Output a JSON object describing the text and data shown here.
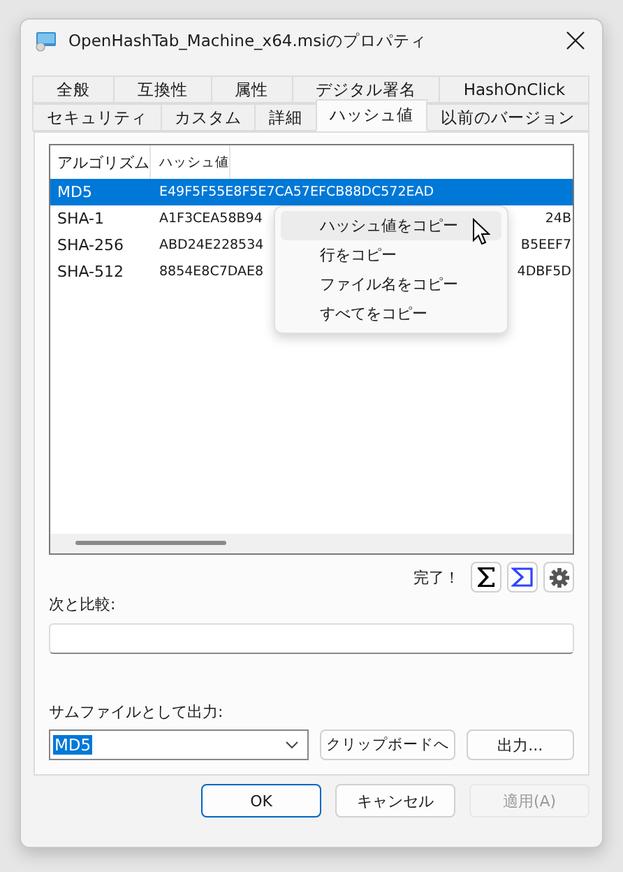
{
  "window": {
    "title": "OpenHashTab_Machine_x64.msiのプロパティ"
  },
  "tab_rows": [
    [
      {
        "label": "全般",
        "selected": false
      },
      {
        "label": "互換性",
        "selected": false
      },
      {
        "label": "属性",
        "selected": false
      },
      {
        "label": "デジタル署名",
        "selected": false
      },
      {
        "label": "HashOnClick",
        "selected": false
      }
    ],
    [
      {
        "label": "セキュリティ",
        "selected": false
      },
      {
        "label": "カスタム",
        "selected": false
      },
      {
        "label": "詳細",
        "selected": false
      },
      {
        "label": "ハッシュ値",
        "selected": true
      },
      {
        "label": "以前のバージョン",
        "selected": false
      }
    ]
  ],
  "table": {
    "columns": [
      "アルゴリズム",
      "ハッシュ値"
    ],
    "rows": [
      {
        "algorithm": "MD5",
        "hash": "E49F5F55E8F5E7CA57EFCB88DC572EAD",
        "hash_end": "",
        "selected": true
      },
      {
        "algorithm": "SHA-1",
        "hash": "A1F3CEA58B94",
        "hash_end": "24B",
        "selected": false
      },
      {
        "algorithm": "SHA-256",
        "hash": "ABD24E228534",
        "hash_end": "B5EEF7",
        "selected": false
      },
      {
        "algorithm": "SHA-512",
        "hash": "8854E8C7DAE8",
        "hash_end": "4DBF5D",
        "selected": false
      }
    ]
  },
  "context_menu": [
    {
      "label": "ハッシュ値をコピー",
      "selected": true
    },
    {
      "label": "行をコピー",
      "selected": false
    },
    {
      "label": "ファイル名をコピー",
      "selected": false
    },
    {
      "label": "すべてをコピー",
      "selected": false
    }
  ],
  "status": "完了！",
  "compare": {
    "label": "次と比較:"
  },
  "export": {
    "label": "サムファイルとして出力:",
    "format": "MD5",
    "buttons": [
      "クリップボードへ",
      "出力..."
    ]
  },
  "footer_buttons": [
    {
      "label": "OK",
      "kind": "default",
      "disabled": false
    },
    {
      "label": "キャンセル",
      "kind": "normal",
      "disabled": false
    },
    {
      "label": "適用(A)",
      "kind": "normal",
      "disabled": true
    }
  ]
}
